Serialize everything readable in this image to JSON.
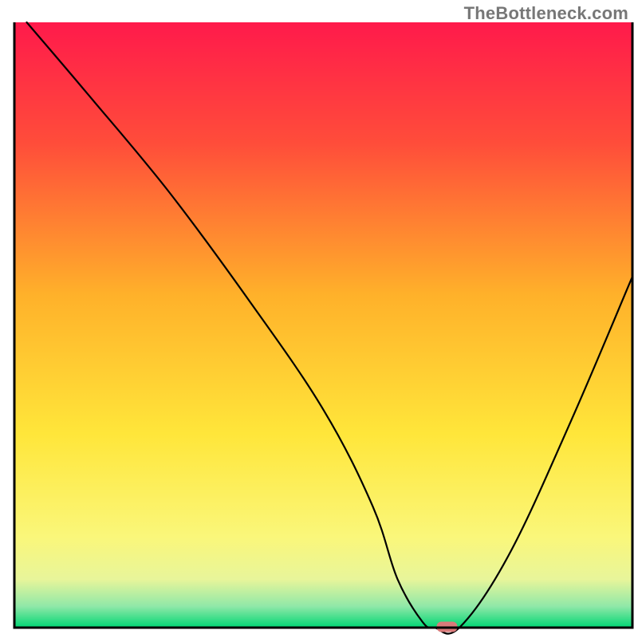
{
  "watermark": {
    "text": "TheBottleneck.com"
  },
  "chart_data": {
    "type": "line",
    "title": "",
    "xlabel": "",
    "ylabel": "",
    "xlim": [
      0,
      100
    ],
    "ylim": [
      0,
      100
    ],
    "grid": false,
    "legend": false,
    "series": [
      {
        "name": "bottleneck-curve",
        "x": [
          2,
          12,
          25,
          38,
          50,
          58,
          62,
          66,
          68,
          72,
          80,
          90,
          100
        ],
        "y": [
          100,
          88,
          72,
          54,
          36,
          20,
          8,
          1,
          0,
          0,
          12,
          34,
          58
        ]
      }
    ],
    "marker": {
      "name": "optimal-point",
      "x": 70,
      "y": 0,
      "color": "#d97a7a"
    },
    "background_gradient": {
      "stops": [
        {
          "pos": 0.0,
          "color": "#ff1a4b"
        },
        {
          "pos": 0.2,
          "color": "#ff4d3a"
        },
        {
          "pos": 0.45,
          "color": "#ffb12a"
        },
        {
          "pos": 0.68,
          "color": "#ffe63a"
        },
        {
          "pos": 0.85,
          "color": "#faf77a"
        },
        {
          "pos": 0.92,
          "color": "#e8f59a"
        },
        {
          "pos": 0.965,
          "color": "#8fe8a8"
        },
        {
          "pos": 1.0,
          "color": "#00d674"
        }
      ]
    },
    "frame_color": "#000000",
    "curve_color": "#000000",
    "curve_width": 2.2
  }
}
